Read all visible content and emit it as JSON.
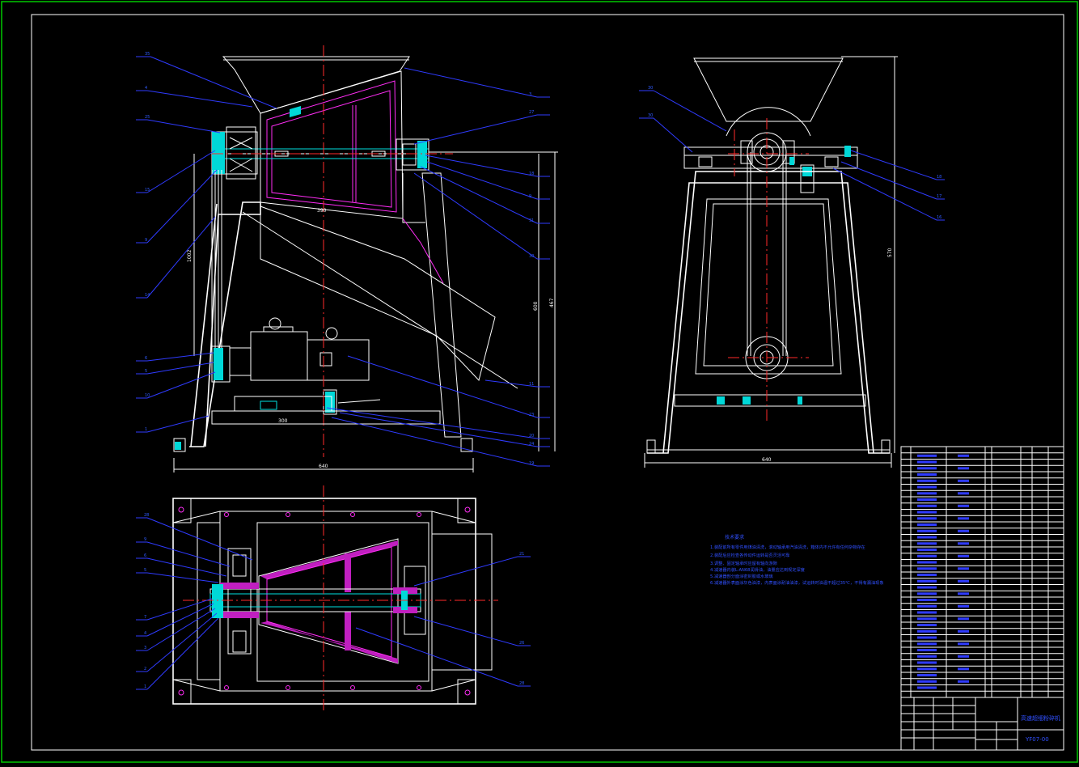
{
  "drawing": {
    "colors": {
      "background": "#000000",
      "outer_frame": "#00c800",
      "outline": "#ffffff",
      "leader": "#2f3bff",
      "centerline": "#ff2a2a",
      "section_cyan": "#00d8d8",
      "section_magenta": "#c01fc0"
    },
    "side_view": {
      "balloons_left": [
        "35",
        "4",
        "25",
        "15",
        "9",
        "14",
        "6",
        "5",
        "10",
        "1"
      ],
      "balloons_right": [
        "3",
        "27",
        "18",
        "9",
        "31",
        "30",
        "11",
        "23",
        "20",
        "24",
        "19"
      ],
      "dimensions": [
        "390",
        "1002",
        "467",
        "600",
        "300",
        "640"
      ]
    },
    "front_view": {
      "balloons_left": [
        "30",
        "30"
      ],
      "balloons_right": [
        "18",
        "17",
        "16"
      ],
      "dimensions": [
        "570",
        "640"
      ]
    },
    "top_view": {
      "balloons_left": [
        "28",
        "9",
        "6",
        "5",
        "7",
        "4",
        "3",
        "2",
        "1"
      ],
      "balloons_right": [
        "21",
        "26",
        "28"
      ]
    },
    "tech_notes": {
      "title": "技术要求",
      "lines": [
        "1.装配前所有零件用煤油清洗，滚动轴承用汽油清洗，箱体内不允许有任何杂物存在",
        "2.装配后应检查各传动件运转是否灵活可靠",
        "3.调整、固定轴承时应留有轴向游隙",
        "4.减速器内装L-AN68润滑油，油量应达到规定深度",
        "5.减速器剖分面涂密封胶或水玻璃",
        "6.减速器外表面涂灰色油漆，内表面涂耐油油漆，试运转时油温不超过35℃，不得有漏油现象"
      ]
    },
    "title_block": {
      "drawing_title": "高速超细粉碎机",
      "drawing_number": "YF07-00"
    }
  }
}
